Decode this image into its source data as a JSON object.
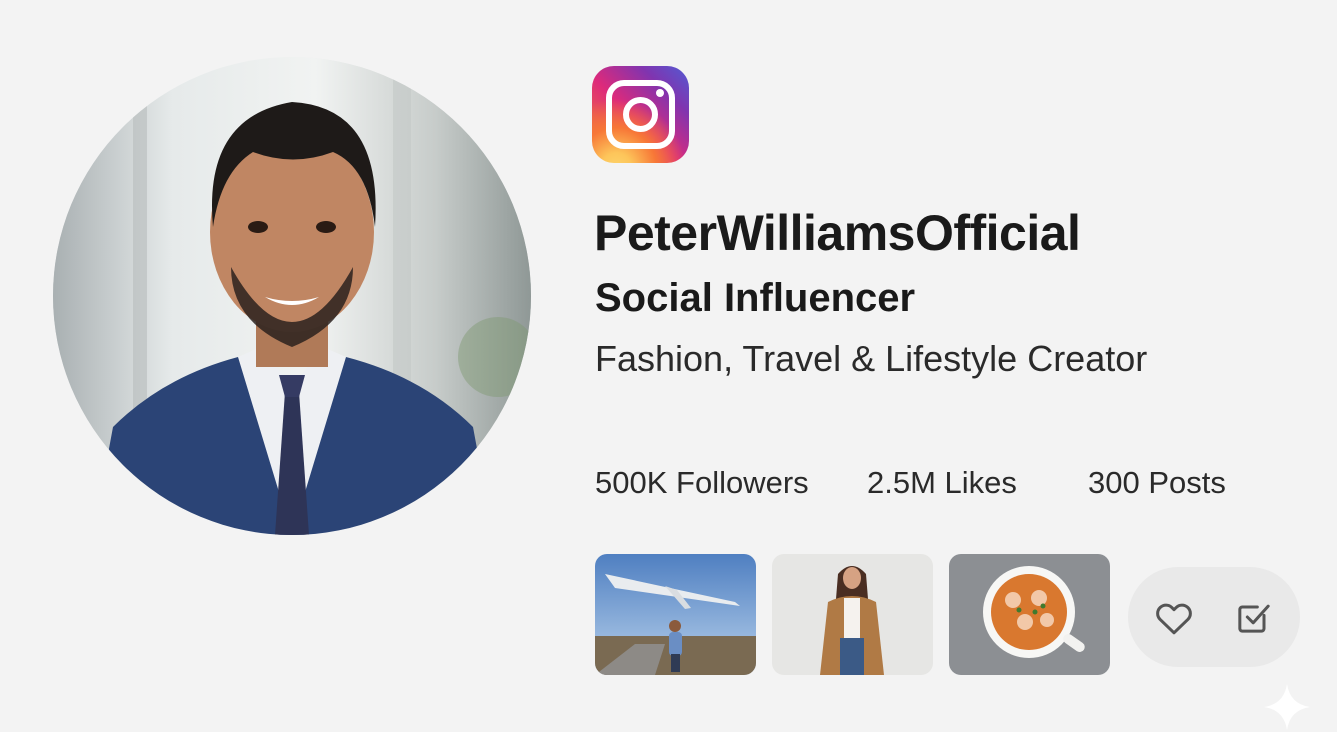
{
  "profile": {
    "username": "PeterWilliamsOfficial",
    "role": "Social Influencer",
    "bio": "Fashion, Travel & Lifestyle Creator"
  },
  "stats": {
    "followers": "500K Followers",
    "likes": "2.5M Likes",
    "posts": "300 Posts"
  },
  "icons": {
    "logo": "instagram-icon",
    "like": "heart-icon",
    "save": "checkbox-icon",
    "corner": "sparkle-icon"
  },
  "colors": {
    "background": "#f3f3f3",
    "text": "#1a1a1a",
    "action_pill": "#e9e9e9",
    "icon_stroke": "#555555"
  }
}
